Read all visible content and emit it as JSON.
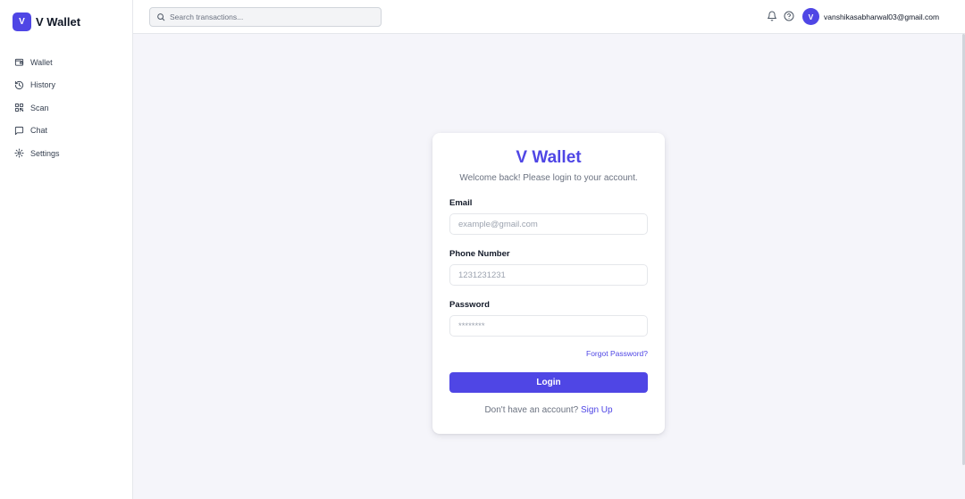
{
  "app": {
    "badge": "V",
    "name": "V Wallet"
  },
  "sidebar": {
    "items": [
      {
        "label": "Wallet",
        "icon": "wallet-icon"
      },
      {
        "label": "History",
        "icon": "history-icon"
      },
      {
        "label": "Scan",
        "icon": "scan-icon"
      },
      {
        "label": "Chat",
        "icon": "chat-icon"
      },
      {
        "label": "Settings",
        "icon": "settings-icon"
      }
    ]
  },
  "header": {
    "search_placeholder": "Search transactions...",
    "icons": [
      "bell-icon",
      "help-icon"
    ],
    "user": {
      "initial": "V",
      "email": "vanshikasabharwal03@gmail.com"
    }
  },
  "login": {
    "title": "V Wallet",
    "subtitle": "Welcome back! Please login to your account.",
    "email_label": "Email",
    "email_placeholder": "example@gmail.com",
    "phone_label": "Phone Number",
    "phone_placeholder": "1231231231",
    "password_label": "Password",
    "password_placeholder": "********",
    "forgot_link": "Forgot Password?",
    "submit_label": "Login",
    "signup_prompt": "Don't have an account?",
    "signup_link": "Sign Up"
  },
  "colors": {
    "accent": "#4f46e5",
    "page_background": "#f5f5fa",
    "muted_text": "#6b7280",
    "border": "#e5e7eb"
  }
}
